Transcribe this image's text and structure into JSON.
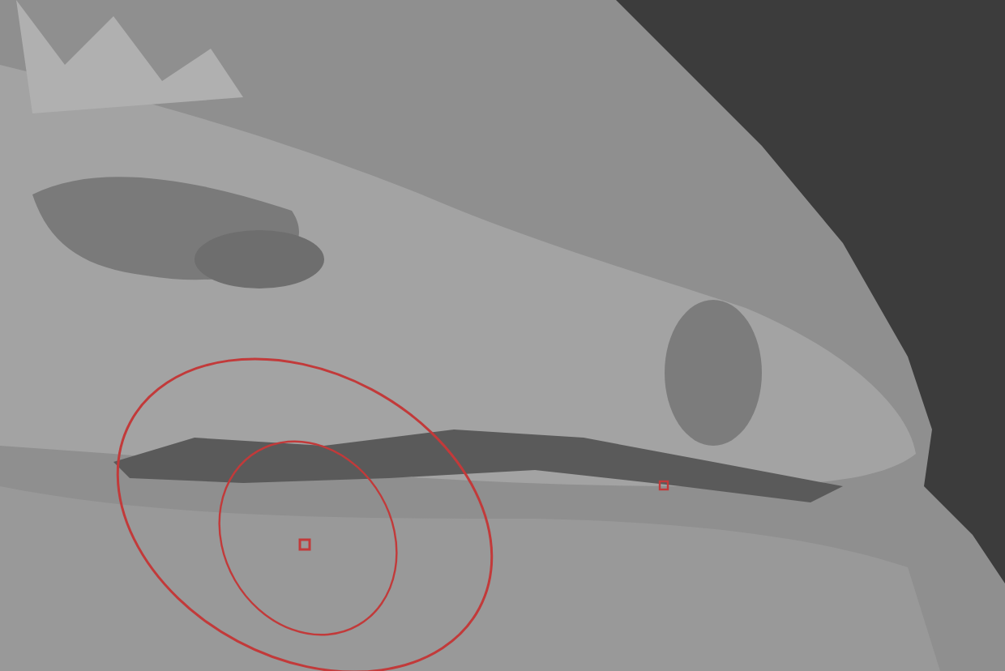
{
  "viewport": {
    "brush_cursor_visible": true
  }
}
